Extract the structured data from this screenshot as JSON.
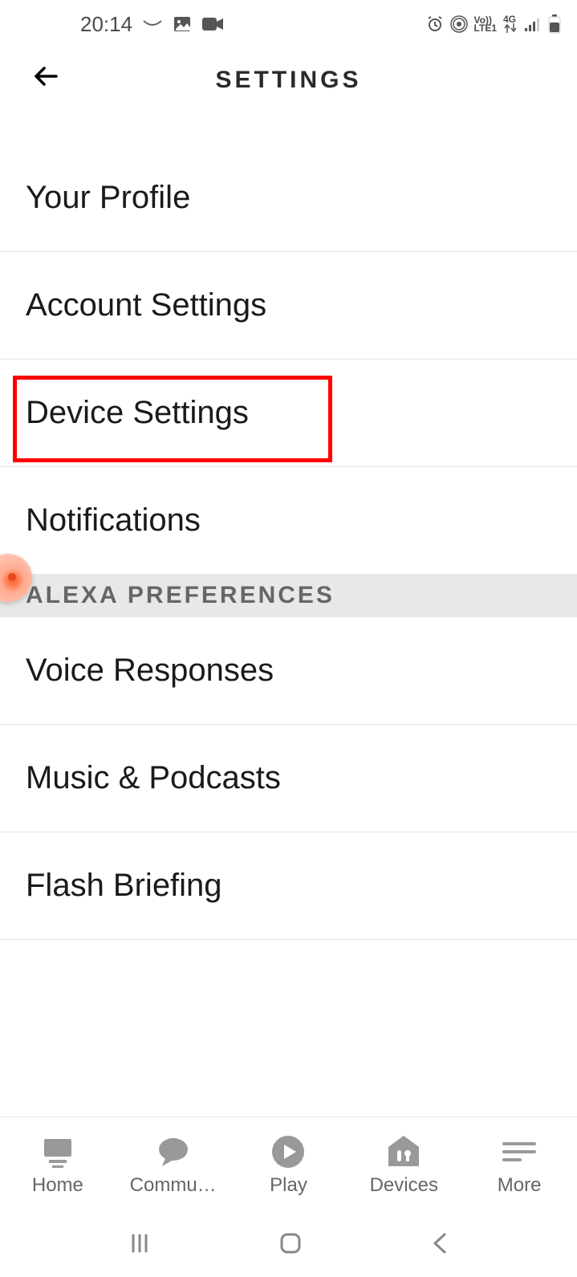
{
  "status": {
    "time": "20:14",
    "indicators": {
      "volte": "Vo))",
      "lte": "LTE1",
      "network": "4G"
    }
  },
  "header": {
    "title": "SETTINGS"
  },
  "settings": {
    "items": [
      {
        "label": "Your Profile"
      },
      {
        "label": "Account Settings"
      },
      {
        "label": "Device Settings"
      },
      {
        "label": "Notifications"
      }
    ]
  },
  "section": {
    "title": "ALEXA PREFERENCES",
    "items": [
      {
        "label": "Voice Responses"
      },
      {
        "label": "Music & Podcasts"
      },
      {
        "label": "Flash Briefing"
      }
    ]
  },
  "bottomNav": {
    "items": [
      {
        "label": "Home"
      },
      {
        "label": "Commu…"
      },
      {
        "label": "Play"
      },
      {
        "label": "Devices"
      },
      {
        "label": "More"
      }
    ]
  }
}
